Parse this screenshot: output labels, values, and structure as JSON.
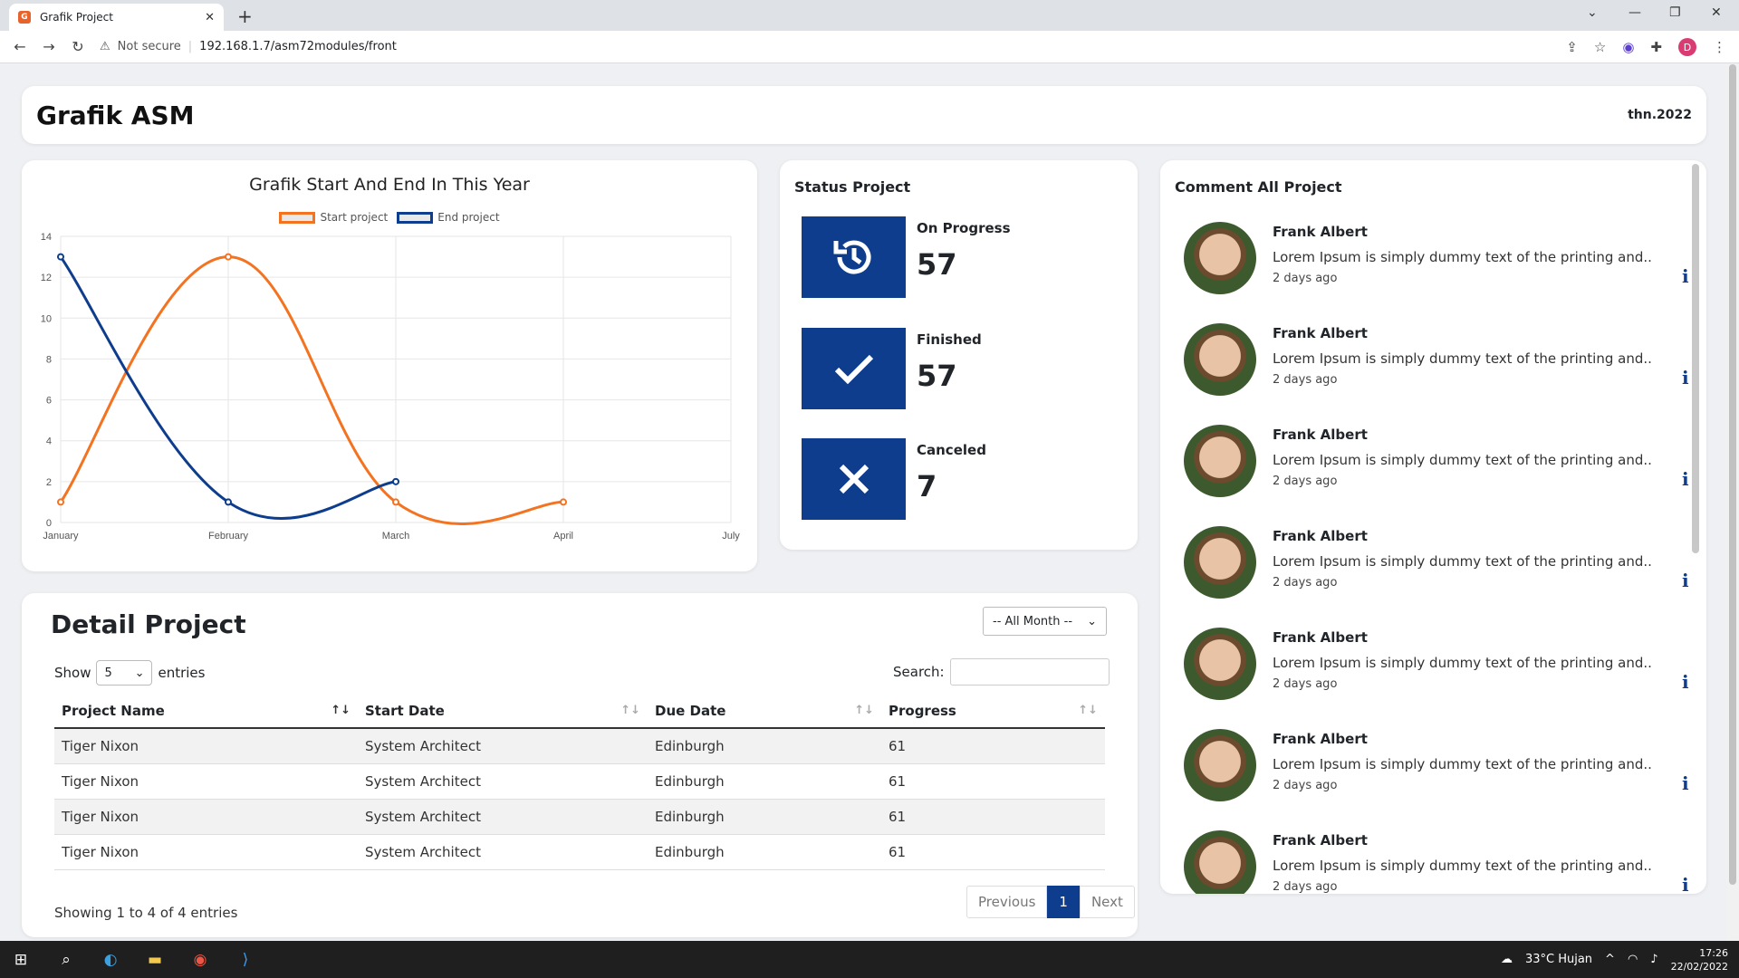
{
  "browser": {
    "tab_title": "Grafik Project",
    "security": "Not secure",
    "url": "192.168.1.7/asm72modules/front",
    "profile": "D"
  },
  "header": {
    "title": "Grafik ASM",
    "year": "thn.2022"
  },
  "chart_data": {
    "type": "line",
    "title": "Grafik Start And End In This Year",
    "categories": [
      "January",
      "February",
      "March",
      "April",
      "July"
    ],
    "ylim": [
      0,
      14
    ],
    "yticks": [
      0,
      2,
      4,
      6,
      8,
      10,
      12,
      14
    ],
    "series": [
      {
        "name": "Start project",
        "color": "#f37321",
        "values": [
          1,
          13,
          1,
          1,
          null
        ]
      },
      {
        "name": "End project",
        "color": "#0d3d8c",
        "values": [
          13,
          1,
          2,
          null,
          null
        ]
      }
    ]
  },
  "status": {
    "title": "Status Project",
    "items": [
      {
        "label": "On Progress",
        "value": "57",
        "icon": "history-icon"
      },
      {
        "label": "Finished",
        "value": "57",
        "icon": "check-icon"
      },
      {
        "label": "Canceled",
        "value": "7",
        "icon": "x-icon"
      }
    ]
  },
  "comments": {
    "title": "Comment All Project",
    "items": [
      {
        "name": "Frank Albert",
        "text": "Lorem Ipsum is simply dummy text of the printing and..",
        "time": "2 days ago"
      },
      {
        "name": "Frank Albert",
        "text": "Lorem Ipsum is simply dummy text of the printing and..",
        "time": "2 days ago"
      },
      {
        "name": "Frank Albert",
        "text": "Lorem Ipsum is simply dummy text of the printing and..",
        "time": "2 days ago"
      },
      {
        "name": "Frank Albert",
        "text": "Lorem Ipsum is simply dummy text of the printing and..",
        "time": "2 days ago"
      },
      {
        "name": "Frank Albert",
        "text": "Lorem Ipsum is simply dummy text of the printing and..",
        "time": "2 days ago"
      },
      {
        "name": "Frank Albert",
        "text": "Lorem Ipsum is simply dummy text of the printing and..",
        "time": "2 days ago"
      },
      {
        "name": "Frank Albert",
        "text": "Lorem Ipsum is simply dummy text of the printing and..",
        "time": "2 days ago"
      }
    ]
  },
  "detail": {
    "title": "Detail Project",
    "month_filter": "-- All Month --",
    "show_label": "Show",
    "entries_value": "5",
    "entries_label": "entries",
    "search_label": "Search:",
    "columns": [
      "Project Name",
      "Start Date",
      "Due Date",
      "Progress"
    ],
    "rows": [
      [
        "Tiger Nixon",
        "System Architect",
        "Edinburgh",
        "61"
      ],
      [
        "Tiger Nixon",
        "System Architect",
        "Edinburgh",
        "61"
      ],
      [
        "Tiger Nixon",
        "System Architect",
        "Edinburgh",
        "61"
      ],
      [
        "Tiger Nixon",
        "System Architect",
        "Edinburgh",
        "61"
      ]
    ],
    "showing": "Showing 1 to 4 of 4 entries",
    "prev": "Previous",
    "page": "1",
    "next": "Next"
  },
  "taskbar": {
    "weather": "33°C  Hujan",
    "time": "17:26",
    "date": "22/02/2022"
  }
}
